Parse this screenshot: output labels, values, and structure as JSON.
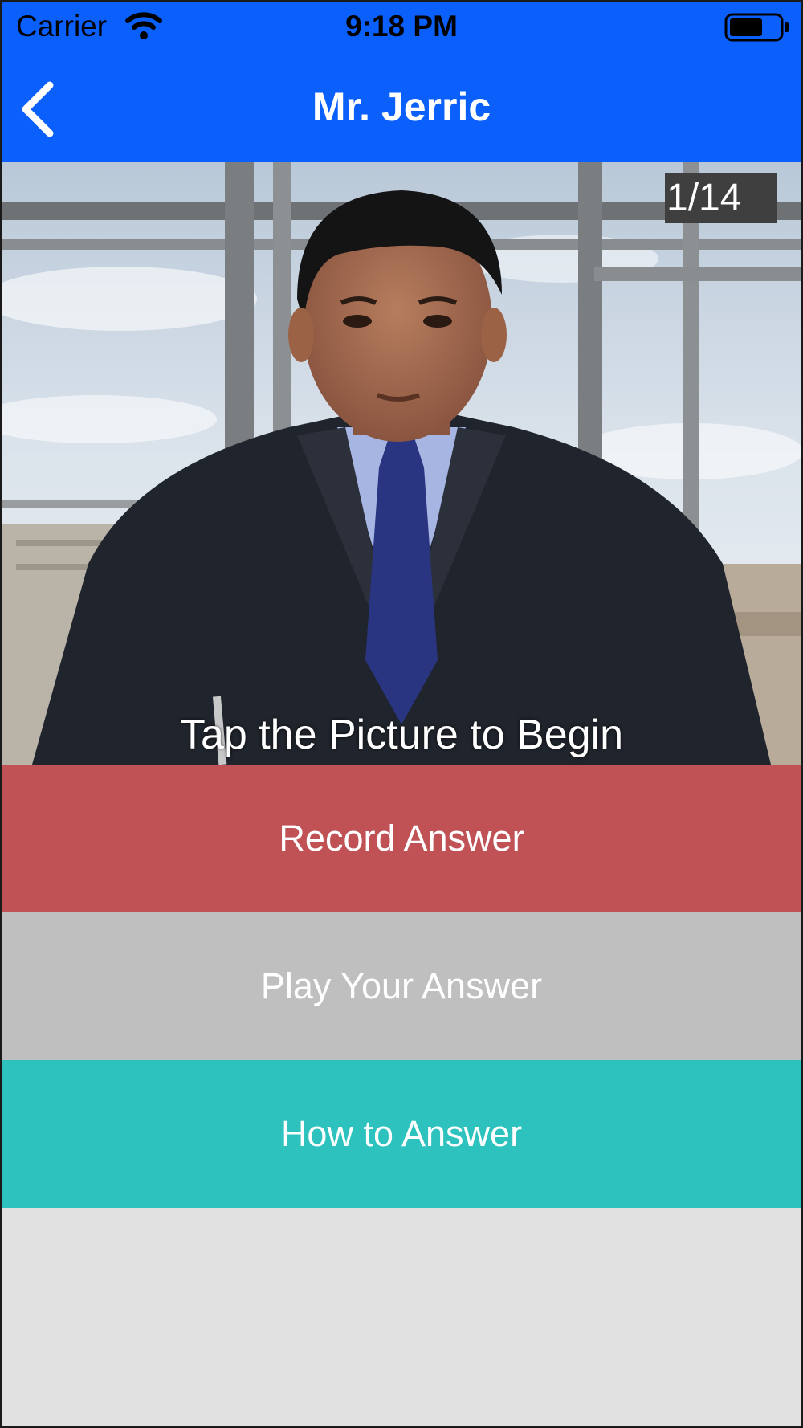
{
  "status_bar": {
    "carrier": "Carrier",
    "time": "9:18 PM",
    "icons": [
      "wifi-icon",
      "battery-icon"
    ]
  },
  "nav_bar": {
    "title": "Mr. Jerric",
    "back_icon": "chevron-left-icon"
  },
  "video": {
    "counter": "1/14",
    "hint": "Tap the Picture to Begin"
  },
  "buttons": {
    "record": "Record Answer",
    "play": "Play Your Answer",
    "how": "How to Answer"
  },
  "colors": {
    "nav": "#0b5ffb",
    "record": "#c05155",
    "play": "#bfbfbf",
    "how": "#2dc2bd",
    "background": "#e1e1e1"
  }
}
